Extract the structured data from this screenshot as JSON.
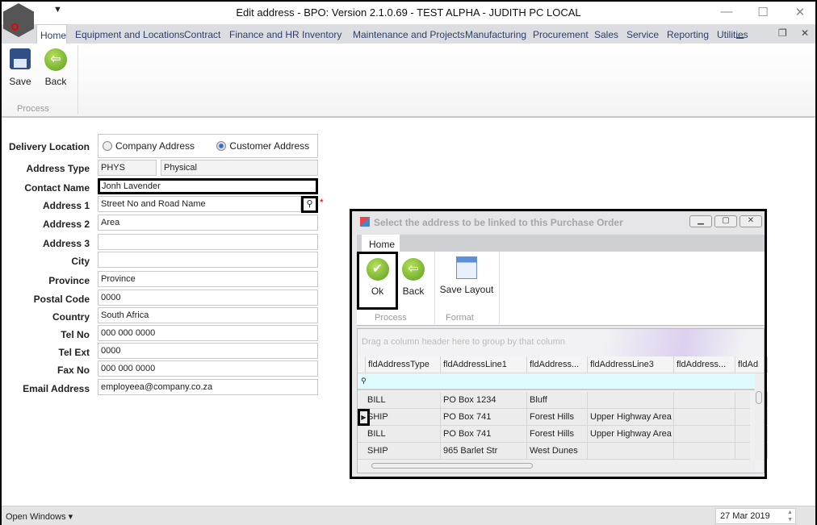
{
  "window": {
    "title": "Edit address - BPO: Version 2.1.0.69 - TEST ALPHA - JUDITH PC LOCAL",
    "qat_icon": "dropdown-arrow-icon",
    "controls": [
      "minimize",
      "maximize",
      "close"
    ]
  },
  "menu": {
    "home": "Home",
    "tabs": [
      "Equipment and Locations",
      "Contract",
      "Finance and HR",
      "Inventory",
      "Maintenance and Projects",
      "Manufacturing",
      "Procurement",
      "Sales",
      "Service",
      "Reporting",
      "Utilities"
    ]
  },
  "ribbon": {
    "save": "Save",
    "back": "Back",
    "group": "Process"
  },
  "form": {
    "delivery_label": "Delivery Location",
    "company_address": "Company Address",
    "customer_address": "Customer Address",
    "selected": "Customer Address",
    "address_type_label": "Address Type",
    "address_type_code": "PHYS",
    "address_type_name": "Physical",
    "fields": [
      {
        "label": "Contact Name",
        "value": "Jonh Lavender"
      },
      {
        "label": "Address 1",
        "value": "Street No and Road Name"
      },
      {
        "label": "Address 2",
        "value": "Area"
      },
      {
        "label": "Address 3",
        "value": ""
      },
      {
        "label": "City",
        "value": ""
      },
      {
        "label": "Province",
        "value": "Province"
      },
      {
        "label": "Postal Code",
        "value": "0000"
      },
      {
        "label": "Country",
        "value": "South Africa"
      },
      {
        "label": "Tel No",
        "value": "000 000 0000"
      },
      {
        "label": "Tel Ext",
        "value": "0000"
      },
      {
        "label": "Fax No",
        "value": "000 000 0000"
      },
      {
        "label": "Email Address",
        "value": "employeea@company.co.za"
      }
    ],
    "required_mark": "*"
  },
  "dialog": {
    "title": "Select the address to be linked to this Purchase Order",
    "tab": "Home",
    "ok": "Ok",
    "back": "Back",
    "save_layout": "Save Layout",
    "group_process": "Process",
    "group_format": "Format",
    "group_panel": "Drag a column header here to group by that column",
    "columns": [
      "fldAddressType",
      "fldAddressLine1",
      "fldAddress...",
      "fldAddressLine3",
      "fldAddress...",
      "fldAd"
    ],
    "rows": [
      [
        "BILL",
        "PO Box 1234",
        "Bluff",
        "",
        "",
        ""
      ],
      [
        "SHIP",
        "PO Box 741",
        "Forest Hills",
        "Upper Highway Area",
        "",
        ""
      ],
      [
        "BILL",
        "PO Box 741",
        "Forest Hills",
        "Upper Highway Area",
        "",
        ""
      ],
      [
        "SHIP",
        "965 Barlet Str",
        "West Dunes",
        "",
        "",
        ""
      ]
    ],
    "selected_row": 1
  },
  "status": {
    "open_windows": "Open Windows ▾",
    "date": "27 Mar 2019"
  },
  "colors": {
    "accent": "#2c3e6b",
    "filter_row": "#e0fbfb",
    "required": "#d00000"
  }
}
